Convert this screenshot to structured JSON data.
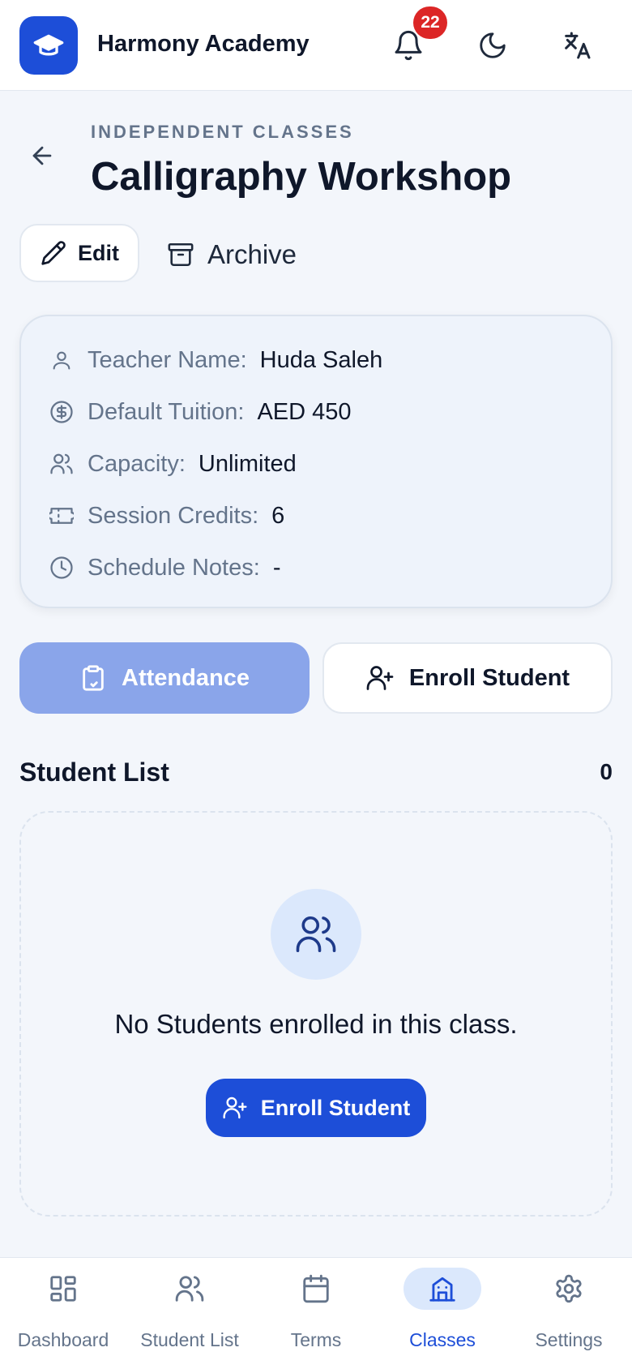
{
  "header": {
    "app_title": "Harmony Academy",
    "notification_count": "22",
    "icons": [
      "graduation-cap-icon",
      "bell-icon",
      "moon-icon",
      "translate-icon"
    ]
  },
  "page": {
    "eyebrow": "INDEPENDENT CLASSES",
    "title": "Calligraphy Workshop",
    "edit_label": "Edit",
    "archive_label": "Archive"
  },
  "info": {
    "teacher": {
      "label": "Teacher Name:",
      "value": "Huda Saleh"
    },
    "tuition": {
      "label": "Default Tuition:",
      "value": "AED 450"
    },
    "capacity": {
      "label": "Capacity:",
      "value": "Unlimited"
    },
    "credits": {
      "label": "Session Credits:",
      "value": "6"
    },
    "notes": {
      "label": "Schedule Notes:",
      "value": "-"
    }
  },
  "actions": {
    "attendance_label": "Attendance",
    "enroll_label": "Enroll Student"
  },
  "students": {
    "section_title": "Student List",
    "count": "0",
    "empty_text": "No Students enrolled in this class.",
    "enroll_label": "Enroll Student"
  },
  "nav": {
    "items": [
      {
        "label": "Dashboard",
        "icon": "dashboard-icon"
      },
      {
        "label": "Student List",
        "icon": "users-icon"
      },
      {
        "label": "Terms",
        "icon": "calendar-icon"
      },
      {
        "label": "Classes",
        "icon": "building-icon",
        "active": true
      },
      {
        "label": "Settings",
        "icon": "gear-icon"
      }
    ]
  },
  "colors": {
    "primary": "#1d4ed8",
    "primary_disabled": "#8aa5ea",
    "badge": "#dc2626",
    "muted_text": "#64748b",
    "background": "#f3f6fb"
  }
}
